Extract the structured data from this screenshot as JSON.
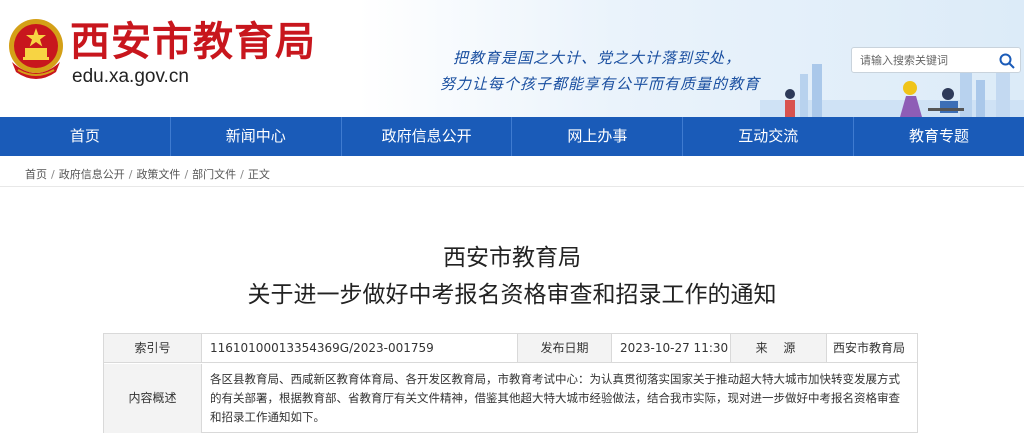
{
  "header": {
    "site_name": "西安市教育局",
    "domain": "edu.xa.gov.cn",
    "slogan_line1": "把教育是国之大计、党之大计落到实处，",
    "slogan_line2": "努力让每个孩子都能享有公平而有质量的教育",
    "search": {
      "placeholder": "请输入搜索关键词"
    }
  },
  "nav": {
    "items": [
      "首页",
      "新闻中心",
      "政府信息公开",
      "网上办事",
      "互动交流",
      "教育专题"
    ]
  },
  "breadcrumb": {
    "items": [
      "首页",
      "政府信息公开",
      "政策文件",
      "部门文件",
      "正文"
    ],
    "separator": "/"
  },
  "article": {
    "title_line1": "西安市教育局",
    "title_line2": "关于进一步做好中考报名资格审查和招录工作的通知"
  },
  "meta": {
    "index_label": "索引号",
    "index_value": "11610100013354369G/2023-001759",
    "date_label": "发布日期",
    "date_value": "2023-10-27 11:30",
    "source_label": "来 源",
    "source_value": "西安市教育局",
    "summary_label": "内容概述",
    "summary_value": "各区县教育局、西咸新区教育体育局、各开发区教育局，市教育考试中心：为认真贯彻落实国家关于推动超大特大城市加快转变发展方式的有关部署，根据教育部、省教育厅有关文件精神，借鉴其他超大特大城市经验做法，结合我市实际，现对进一步做好中考报名资格审查和招录工作通知如下。"
  },
  "colors": {
    "brand_red": "#c8161d",
    "nav_blue": "#1a5bb8",
    "slogan_blue": "#1a4fa0"
  },
  "icons": [
    "national-emblem-icon",
    "search-icon"
  ]
}
